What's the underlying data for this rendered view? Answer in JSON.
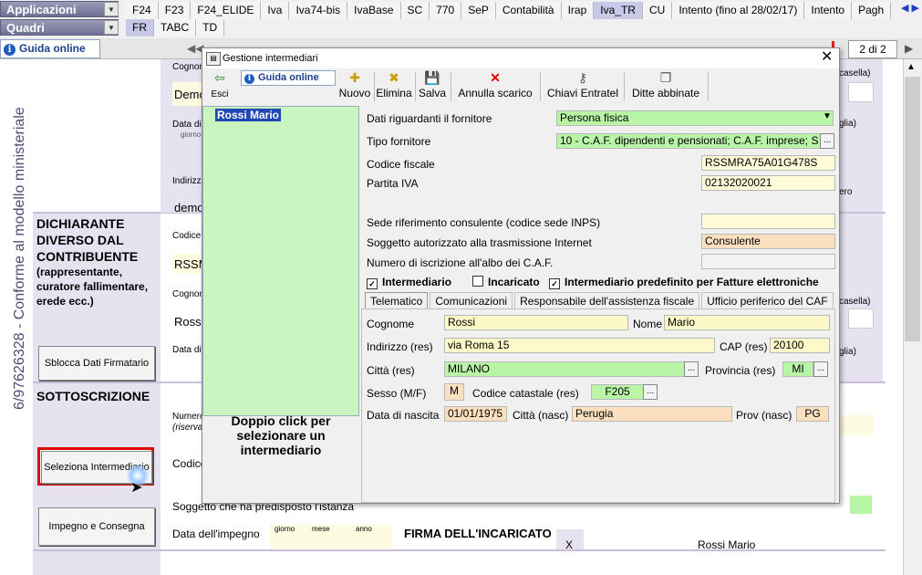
{
  "menu": {
    "applicazioni": "Applicazioni",
    "quadri": "Quadri",
    "tabs_row1": [
      "F24",
      "F23",
      "F24_ELIDE",
      "Iva",
      "Iva74-bis",
      "IvaBase",
      "SC",
      "770",
      "SeP",
      "Contabilità",
      "Irap",
      "Iva_TR",
      "CU",
      "Intento (fino al 28/02/17)",
      "Intento",
      "Pagh"
    ],
    "tabs_row2": [
      "FR",
      "TABC",
      "TD"
    ],
    "active_tab": "Iva_TR",
    "help": "Guida online",
    "page_counter": "2 di 2"
  },
  "document": {
    "sidebar": "6/97626328 - Conforme al modello ministeriale",
    "cognome": "Cognome",
    "demo1": "Demo",
    "data_di": "Data di",
    "giorno": "giorno",
    "indirizzo": "Indirizzo",
    "demo2": "demo",
    "dichiarante": "DICHIARANTE DIVERSO DAL CONTRIBUENTE",
    "dichiarante_sub": "(rappresentante, curatore fallimentare, erede ecc.)",
    "codice": "Codice",
    "rssm": "RSSM",
    "cognome2": "Cognome",
    "ross": "Ross",
    "sblocca": "Sblocca Dati Firmatario",
    "sottoscrizione": "SOTTOSCRIZIONE",
    "numero": "Numero",
    "riserva": "(riserva",
    "codice2": "Codice",
    "seleziona": "Seleziona Intermediario",
    "soggetto": "Soggetto che ha predisposto l'istanza",
    "impegno": "Impegno e Consegna",
    "data_impegno": "Data dell'impegno",
    "giorno2": "giorno",
    "mese": "mese",
    "anno": "anno",
    "firma": "FIRMA DELL'INCARICATO",
    "x": "X",
    "firma_nome": "Rossi Mario",
    "casella": "casella)",
    "glia": "glia)",
    "ero": "ero",
    "casella2": "casella)",
    "glia2": "glia)"
  },
  "dialog": {
    "title": "Gestione intermediari",
    "toolbar": {
      "esci": "Esci",
      "guida": "Guida online",
      "nuovo": "Nuovo",
      "elimina": "Elimina",
      "salva": "Salva",
      "annulla": "Annulla scarico",
      "chiavi": "Chiavi Entratel",
      "ditte": "Ditte abbinate"
    },
    "list": {
      "items": [
        "Rossi  Mario"
      ],
      "hint": "Doppio click per selezionare un intermediario"
    },
    "form": {
      "fornitore_label": "Dati riguardanti il fornitore",
      "fornitore_value": "Persona fisica",
      "tipo_label": "Tipo fornitore",
      "tipo_value": "10 - C.A.F. dipendenti e pensionati; C.A.F. imprese; S",
      "cf_label": "Codice fiscale",
      "cf_value": "RSSMRA75A01G478S",
      "piva_label": "Partita IVA",
      "piva_value": "02132020021",
      "sede_label": "Sede riferimento consulente (codice sede INPS)",
      "sede_value": "",
      "soggetto_label": "Soggetto autorizzato alla trasmissione Internet",
      "soggetto_value": "Consulente",
      "albo_label": "Numero di iscrizione all'albo dei C.A.F.",
      "albo_value": "",
      "chk_intermediario": "Intermediario",
      "chk_incaricato": "Incaricato",
      "chk_predefinito": "Intermediario predefinito per Fatture elettroniche"
    },
    "subtabs": [
      "Telematico",
      "Comunicazioni",
      "Responsabile dell'assistenza fiscale",
      "Ufficio periferico del CAF"
    ],
    "telematico": {
      "cognome_label": "Cognome",
      "cognome_value": "Rossi",
      "nome_label": "Nome",
      "nome_value": "Mario",
      "indirizzo_label": "Indirizzo (res)",
      "indirizzo_value": "via Roma 15",
      "cap_label": "CAP (res)",
      "cap_value": "20100",
      "citta_label": "Città (res)",
      "citta_value": "MILANO",
      "provincia_label": "Provincia (res)",
      "provincia_value": "MI",
      "sesso_label": "Sesso (M/F)",
      "sesso_value": "M",
      "catastale_label": "Codice catastale (res)",
      "catastale_value": "F205",
      "nascita_label": "Data di nascita",
      "nascita_value": "01/01/1975",
      "citta_nasc_label": "Città (nasc)",
      "citta_nasc_value": "Perugia",
      "prov_nasc_label": "Prov (nasc)",
      "prov_nasc_value": "PG"
    }
  },
  "colors": {
    "green_field": "#b8f5a6",
    "yellow_field": "#fdf8c8",
    "orange_field": "#fbe0c0",
    "accent": "#c8c8e8",
    "highlight_red": "#e00000"
  }
}
